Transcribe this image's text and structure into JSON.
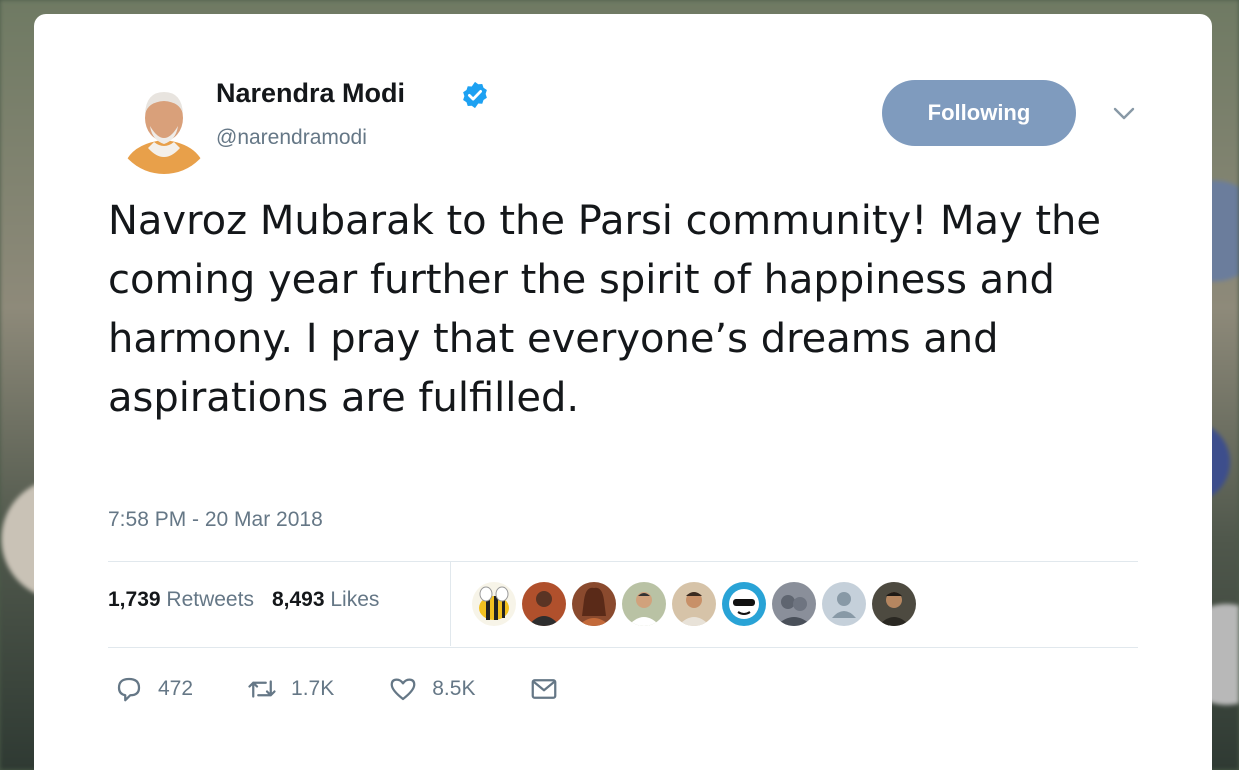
{
  "tweet": {
    "author_name": "Narendra Modi",
    "author_handle": "@narendramodi",
    "follow_label": "Following",
    "text": "Navroz Mubarak to the Parsi community! May the coming year further the spirit of happiness and harmony. I pray that everyone’s dreams and aspirations are fulfilled.",
    "timestamp": "7:58 PM - 20 Mar 2018",
    "retweets_count": "1,739",
    "retweets_label": "Retweets",
    "likes_count": "8,493",
    "likes_label": "Likes",
    "actions": {
      "reply_count": "472",
      "retweet_count": "1.7K",
      "like_count": "8.5K"
    }
  },
  "icons": {
    "verified": "verified-badge-icon",
    "chevron": "chevron-down-icon",
    "reply": "reply-icon",
    "retweet": "retweet-icon",
    "like": "heart-icon",
    "dm": "envelope-icon"
  },
  "colors": {
    "follow_button": "#7f9bbe",
    "verified": "#1da1f2",
    "text_primary": "#14171a",
    "text_secondary": "#657786"
  },
  "likers": [
    {
      "icon": "liker-avatar-bee",
      "bg": "#f2c020"
    },
    {
      "icon": "liker-avatar-person",
      "bg": "#b0502c"
    },
    {
      "icon": "liker-avatar-person",
      "bg": "#8a4a2e"
    },
    {
      "icon": "liker-avatar-person",
      "bg": "#9fb08a"
    },
    {
      "icon": "liker-avatar-person",
      "bg": "#d6c3a8"
    },
    {
      "icon": "liker-avatar-cartoon",
      "bg": "#29a3d6"
    },
    {
      "icon": "liker-avatar-person",
      "bg": "#8a8f9a"
    },
    {
      "icon": "liker-avatar-default",
      "bg": "#c5d0da"
    },
    {
      "icon": "liker-avatar-person",
      "bg": "#4d4a40"
    }
  ]
}
